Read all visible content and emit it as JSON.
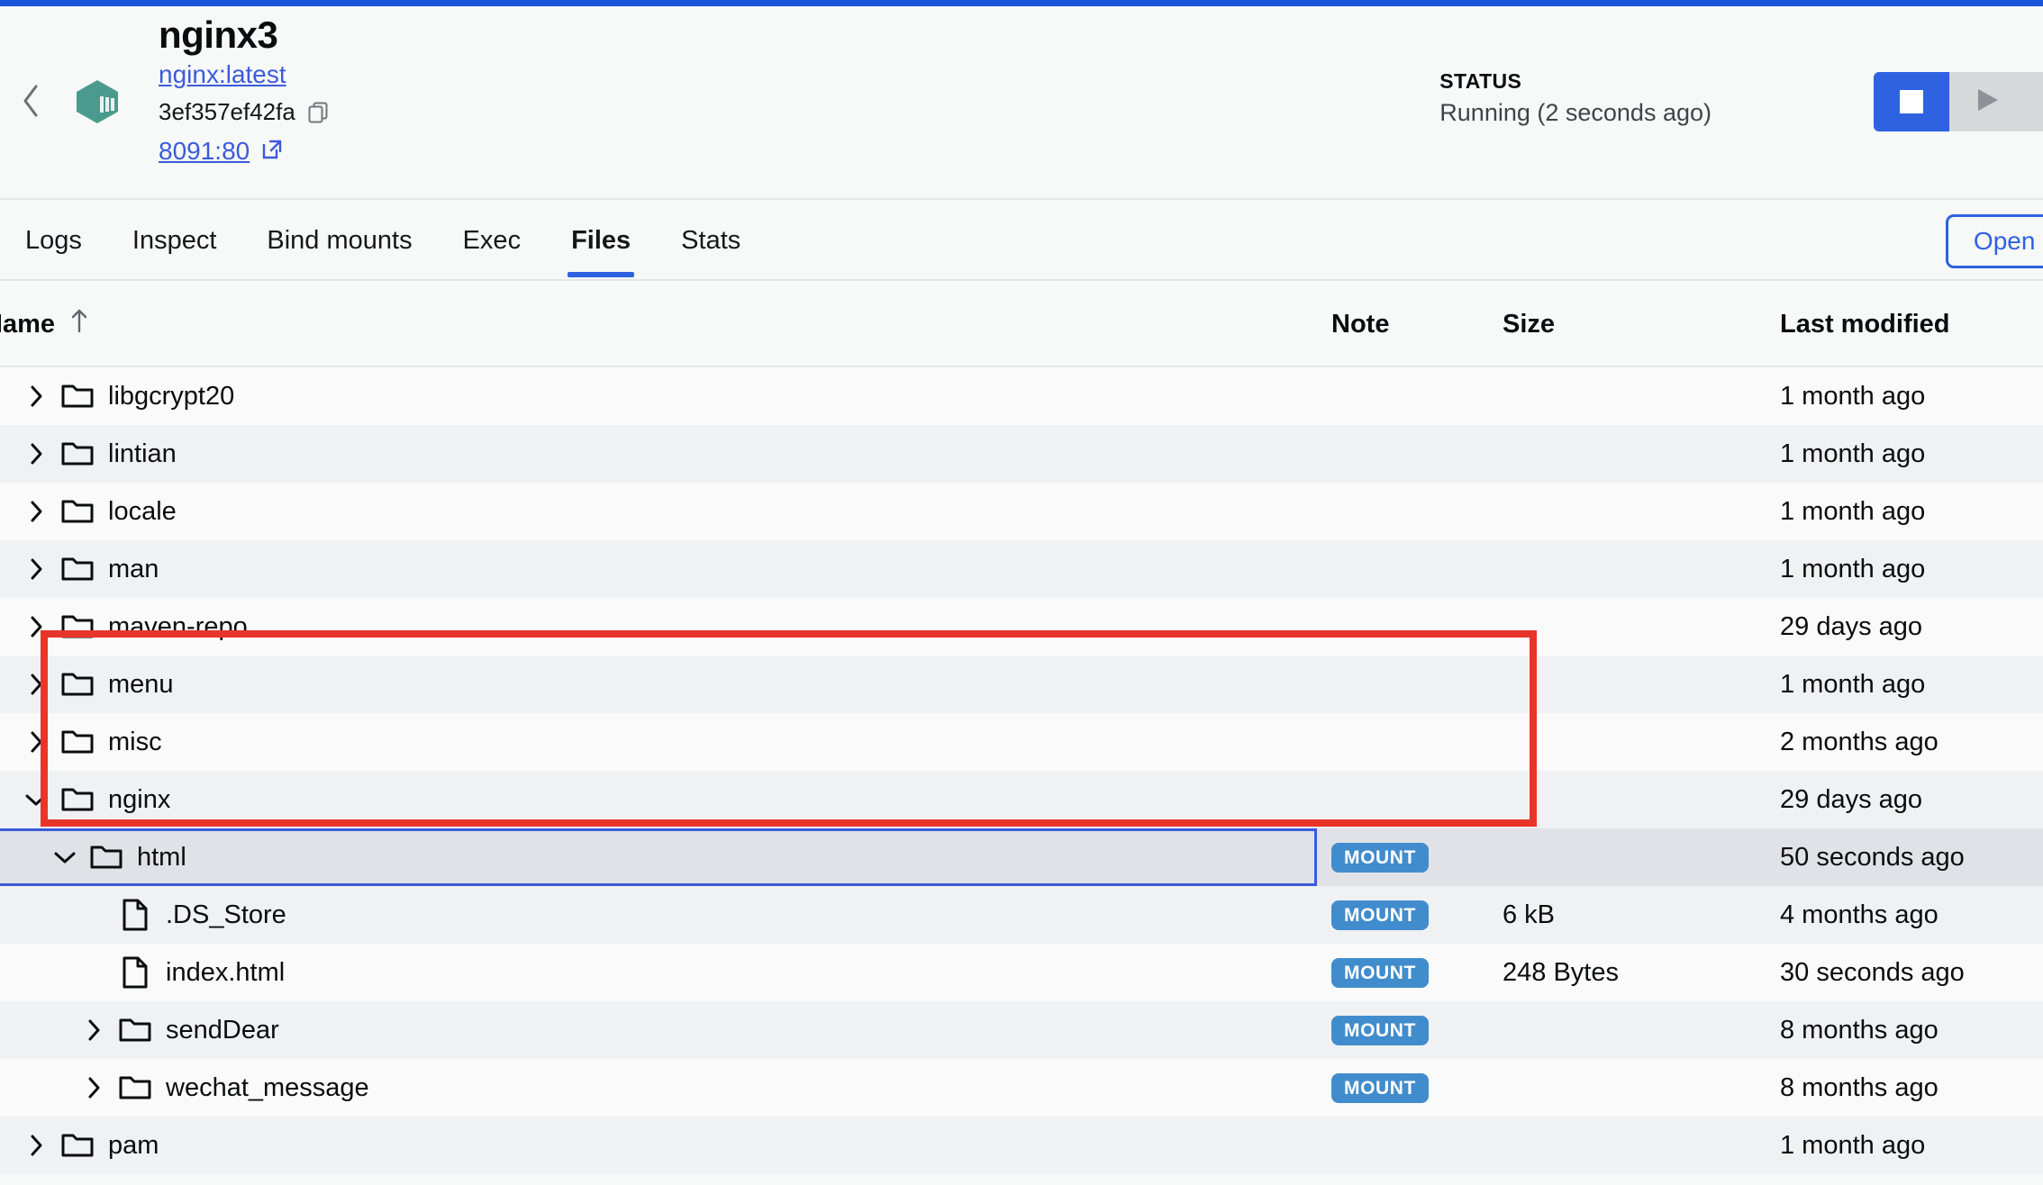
{
  "header": {
    "back_icon": "chevron-left-icon",
    "container_icon": "docker-container-icon",
    "title": "nginx3",
    "image": "nginx:latest",
    "container_id": "3ef357ef42fa",
    "copy_icon": "copy-icon",
    "port": "8091:80",
    "external_link_icon": "external-link-icon",
    "status_label": "STATUS",
    "status_value": "Running (2 seconds ago)",
    "stop_button": "stop-icon",
    "start_button": "play-icon",
    "accent_color": "#1a56db",
    "status_button_color": "#2f62e0"
  },
  "tabs": [
    {
      "label": "Logs",
      "active": false
    },
    {
      "label": "Inspect",
      "active": false
    },
    {
      "label": "Bind mounts",
      "active": false
    },
    {
      "label": "Exec",
      "active": false
    },
    {
      "label": "Files",
      "active": true
    },
    {
      "label": "Stats",
      "active": false
    }
  ],
  "toolbar": {
    "open_button_label": "Open in"
  },
  "table": {
    "columns": {
      "name": "Name",
      "note": "Note",
      "size": "Size",
      "last_modified": "Last modified"
    },
    "sort_icon": "arrow-up-icon",
    "badge_label": "MOUNT",
    "rows": [
      {
        "name": "libgcrypt20",
        "type": "folder",
        "depth": 0,
        "expanded": false,
        "note": "",
        "size": "",
        "modified": "1 month ago",
        "selected": false
      },
      {
        "name": "lintian",
        "type": "folder",
        "depth": 0,
        "expanded": false,
        "note": "",
        "size": "",
        "modified": "1 month ago",
        "selected": false
      },
      {
        "name": "locale",
        "type": "folder",
        "depth": 0,
        "expanded": false,
        "note": "",
        "size": "",
        "modified": "1 month ago",
        "selected": false
      },
      {
        "name": "man",
        "type": "folder",
        "depth": 0,
        "expanded": false,
        "note": "",
        "size": "",
        "modified": "1 month ago",
        "selected": false
      },
      {
        "name": "maven-repo",
        "type": "folder",
        "depth": 0,
        "expanded": false,
        "note": "",
        "size": "",
        "modified": "29 days ago",
        "selected": false
      },
      {
        "name": "menu",
        "type": "folder",
        "depth": 0,
        "expanded": false,
        "note": "",
        "size": "",
        "modified": "1 month ago",
        "selected": false
      },
      {
        "name": "misc",
        "type": "folder",
        "depth": 0,
        "expanded": false,
        "note": "",
        "size": "",
        "modified": "2 months ago",
        "selected": false
      },
      {
        "name": "nginx",
        "type": "folder",
        "depth": 0,
        "expanded": true,
        "note": "",
        "size": "",
        "modified": "29 days ago",
        "selected": false
      },
      {
        "name": "html",
        "type": "folder",
        "depth": 1,
        "expanded": true,
        "note": "MOUNT",
        "size": "",
        "modified": "50 seconds ago",
        "selected": true
      },
      {
        "name": ".DS_Store",
        "type": "file",
        "depth": 2,
        "expanded": false,
        "note": "MOUNT",
        "size": "6 kB",
        "modified": "4 months ago",
        "selected": false
      },
      {
        "name": "index.html",
        "type": "file",
        "depth": 2,
        "expanded": false,
        "note": "MOUNT",
        "size": "248 Bytes",
        "modified": "30 seconds ago",
        "selected": false
      },
      {
        "name": "sendDear",
        "type": "folder",
        "depth": 2,
        "expanded": false,
        "note": "MOUNT",
        "size": "",
        "modified": "8 months ago",
        "selected": false
      },
      {
        "name": "wechat_message",
        "type": "folder",
        "depth": 2,
        "expanded": false,
        "note": "MOUNT",
        "size": "",
        "modified": "8 months ago",
        "selected": false
      },
      {
        "name": "pam",
        "type": "folder",
        "depth": 0,
        "expanded": false,
        "note": "",
        "size": "",
        "modified": "1 month ago",
        "selected": false
      }
    ]
  },
  "annotation": {
    "color": "#e8352a",
    "shape": "rectangle"
  }
}
